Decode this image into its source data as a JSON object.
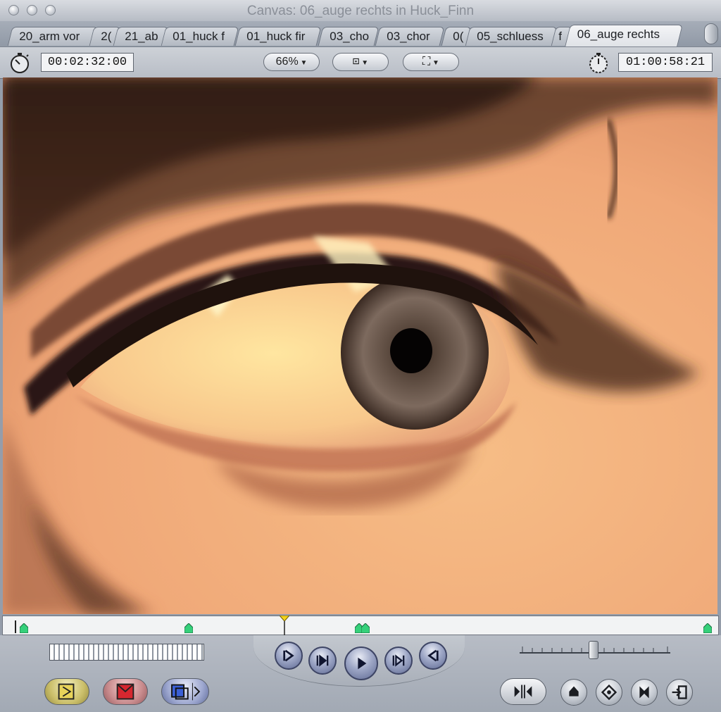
{
  "window": {
    "title": "Canvas: 06_auge rechts in Huck_Finn"
  },
  "tabs": [
    {
      "label": "20_arm vor"
    },
    {
      "label": "2("
    },
    {
      "label": "21_ab"
    },
    {
      "label": "01_huck f"
    },
    {
      "label": "01_huck fir"
    },
    {
      "label": "03_cho"
    },
    {
      "label": "03_chor"
    },
    {
      "label": "0("
    },
    {
      "label": "05_schluess"
    },
    {
      "label": "f"
    },
    {
      "label": "06_auge rechts"
    }
  ],
  "toolbar": {
    "duration_timecode": "00:02:32:00",
    "zoom": "66%",
    "current_timecode": "01:00:58:21"
  },
  "colors": {
    "accent_marker": "#35d07a",
    "playhead": "#f3d21b",
    "mark_in": "#e8d35a",
    "mark_out": "#d6272f"
  }
}
